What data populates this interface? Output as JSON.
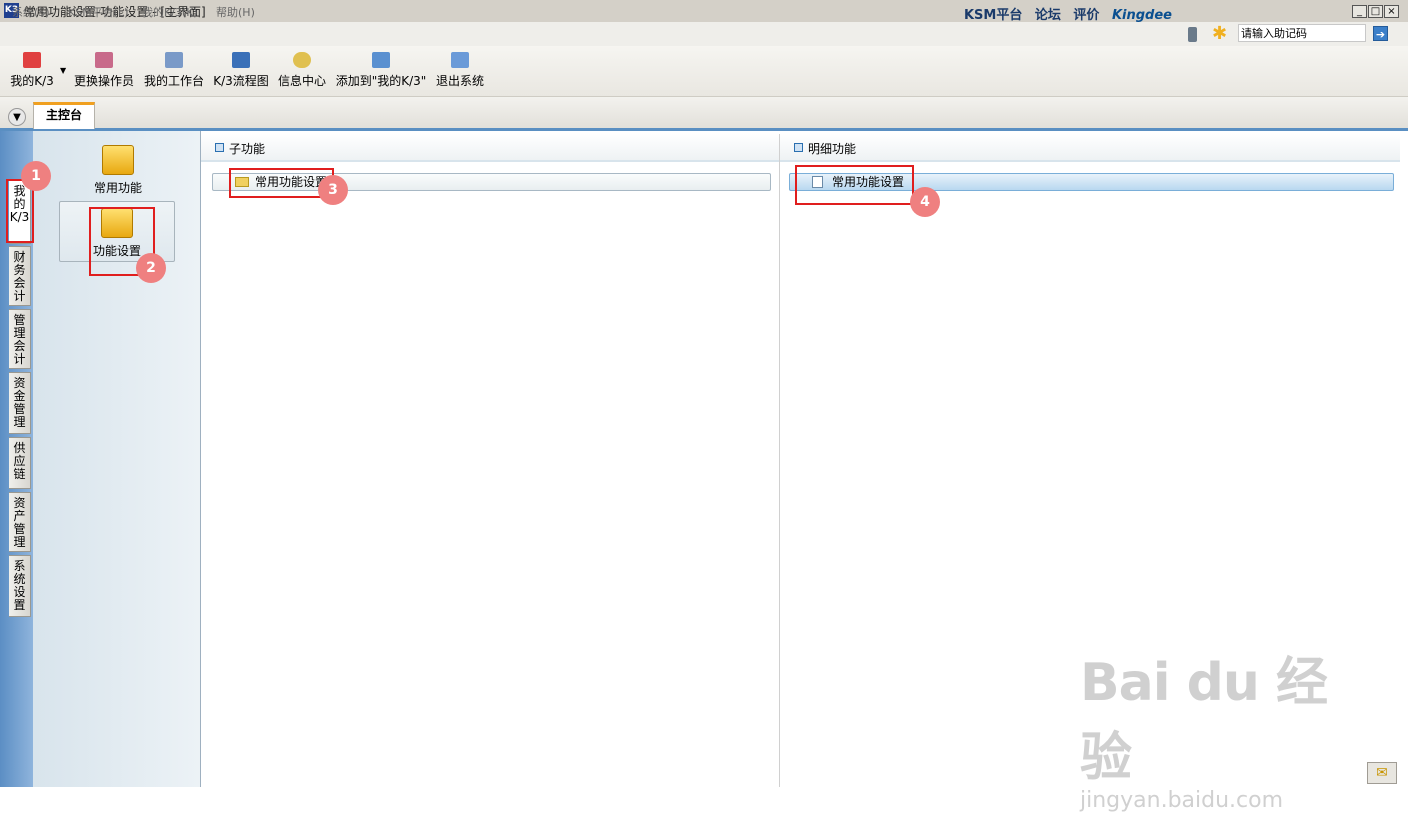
{
  "window": {
    "title": "常用功能设置-功能设置 - [主界面]",
    "app_icon": "K3",
    "controls": [
      "_",
      "□",
      "×"
    ]
  },
  "menubar": {
    "items": [
      "系统(S)",
      "KSM平台(L)",
      "我的K/3(K)",
      "帮助(H)"
    ],
    "links": [
      "KSM平台",
      "论坛",
      "评价"
    ],
    "brand": "Kingdee",
    "help_input_value": "请输入助记码"
  },
  "toolbar": {
    "buttons": [
      {
        "label": "我的K/3",
        "icon": "star-icon"
      },
      {
        "label": "更换操作员",
        "icon": "users-icon"
      },
      {
        "label": "我的工作台",
        "icon": "pen-icon"
      },
      {
        "label": "K/3流程图",
        "icon": "flowchart-icon"
      },
      {
        "label": "信息中心",
        "icon": "message-icon"
      },
      {
        "label": "添加到\"我的K/3\"",
        "icon": "add-note-icon"
      },
      {
        "label": "退出系统",
        "icon": "exit-icon"
      }
    ]
  },
  "tabs": {
    "main": "主控台"
  },
  "leftnav": {
    "items": [
      "我的K/3",
      "财务会计",
      "管理会计",
      "资金管理",
      "供应链",
      "资产管理",
      "系统设置"
    ]
  },
  "modules": {
    "items": [
      "常用功能",
      "功能设置"
    ]
  },
  "panes": {
    "sub_title": "子功能",
    "detail_title": "明细功能",
    "sub_item": "常用功能设置",
    "detail_item": "常用功能设置"
  },
  "annotations": [
    "1",
    "2",
    "3",
    "4"
  ],
  "watermark": {
    "main": "Bai du 经验",
    "sub": "jingyan.baidu.com"
  },
  "colors": {
    "accent_blue": "#5a8fc2",
    "tab_orange": "#f0a020",
    "annotation_red": "#e01e1e",
    "badge_pink": "#ef8080"
  }
}
